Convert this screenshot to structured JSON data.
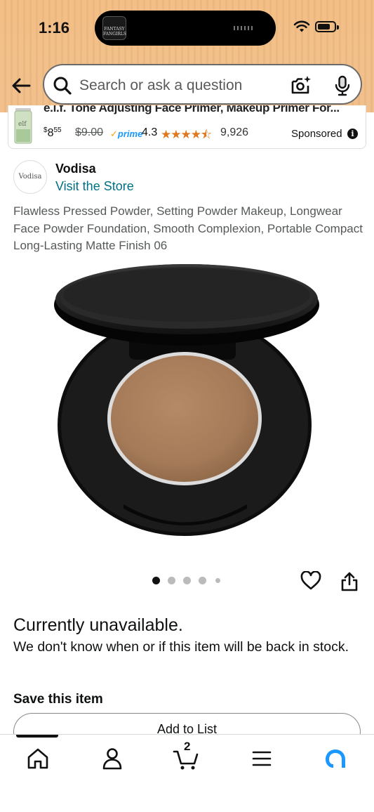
{
  "status_bar": {
    "time": "1:16",
    "island_app": "FANTASY FANGIRLS"
  },
  "search": {
    "placeholder": "Search or ask a question"
  },
  "sponsored": {
    "title": "e.l.f. Tone Adjusting Face Primer, Makeup Primer For...",
    "brand_on_thumb": "elf",
    "price_currency": "$",
    "price_whole": "8",
    "price_fraction": "55",
    "list_price": "$9.00",
    "prime_label": "prime",
    "rating": "4.3",
    "stars": "★★★★⯪",
    "review_count": "9,926",
    "label": "Sponsored"
  },
  "brand": {
    "logo_text": "Vodisa",
    "name": "Vodisa",
    "store_link": "Visit the Store"
  },
  "product": {
    "title": "Flawless Pressed Powder, Setting Powder Makeup, Longwear Face Powder Foundation, Smooth Complexion, Portable Compact Long-Lasting Matte Finish 06",
    "image_count": 5,
    "active_image": 1
  },
  "availability": {
    "heading": "Currently unavailable.",
    "message": "We don't know when or if this item will be back in stock."
  },
  "save": {
    "heading": "Save this item",
    "add_to_list": "Add to List"
  },
  "tabbar": {
    "cart_count": "2",
    "active_tab": "home"
  },
  "colors": {
    "header_bg": "#f3bf86",
    "link": "#007185",
    "star": "#de7921",
    "prime": "#1a98ff",
    "alexa": "#1a98ff"
  }
}
